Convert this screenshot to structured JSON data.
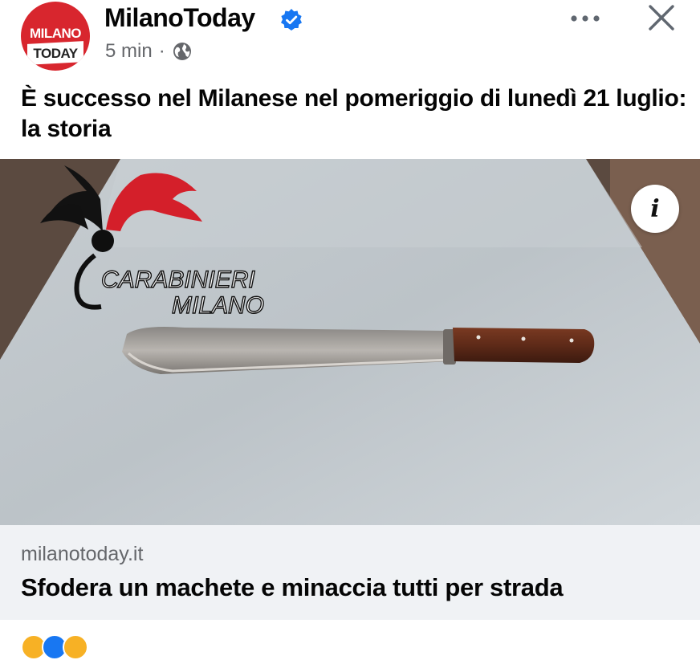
{
  "post": {
    "page_name": "MilanoToday",
    "avatar_line1": "MILANO",
    "avatar_line2": "TODAY",
    "timestamp": "5 min",
    "separator": "·",
    "audience_icon": "globe-icon",
    "verified_icon": "verified-badge-icon",
    "text": "È successo nel Milanese nel pomeriggio di lunedì 21 luglio: la storia"
  },
  "image": {
    "watermark_line1": "CARABINIERI",
    "watermark_line2": "MILANO",
    "info_label": "i"
  },
  "link": {
    "domain": "milanotoday.it",
    "title": "Sfodera un machete e minaccia tutti per strada"
  },
  "colors": {
    "brand_red": "#d8262e",
    "verified_blue": "#1877f2",
    "secondary_text": "#65676b",
    "link_bg": "#f0f2f5"
  }
}
